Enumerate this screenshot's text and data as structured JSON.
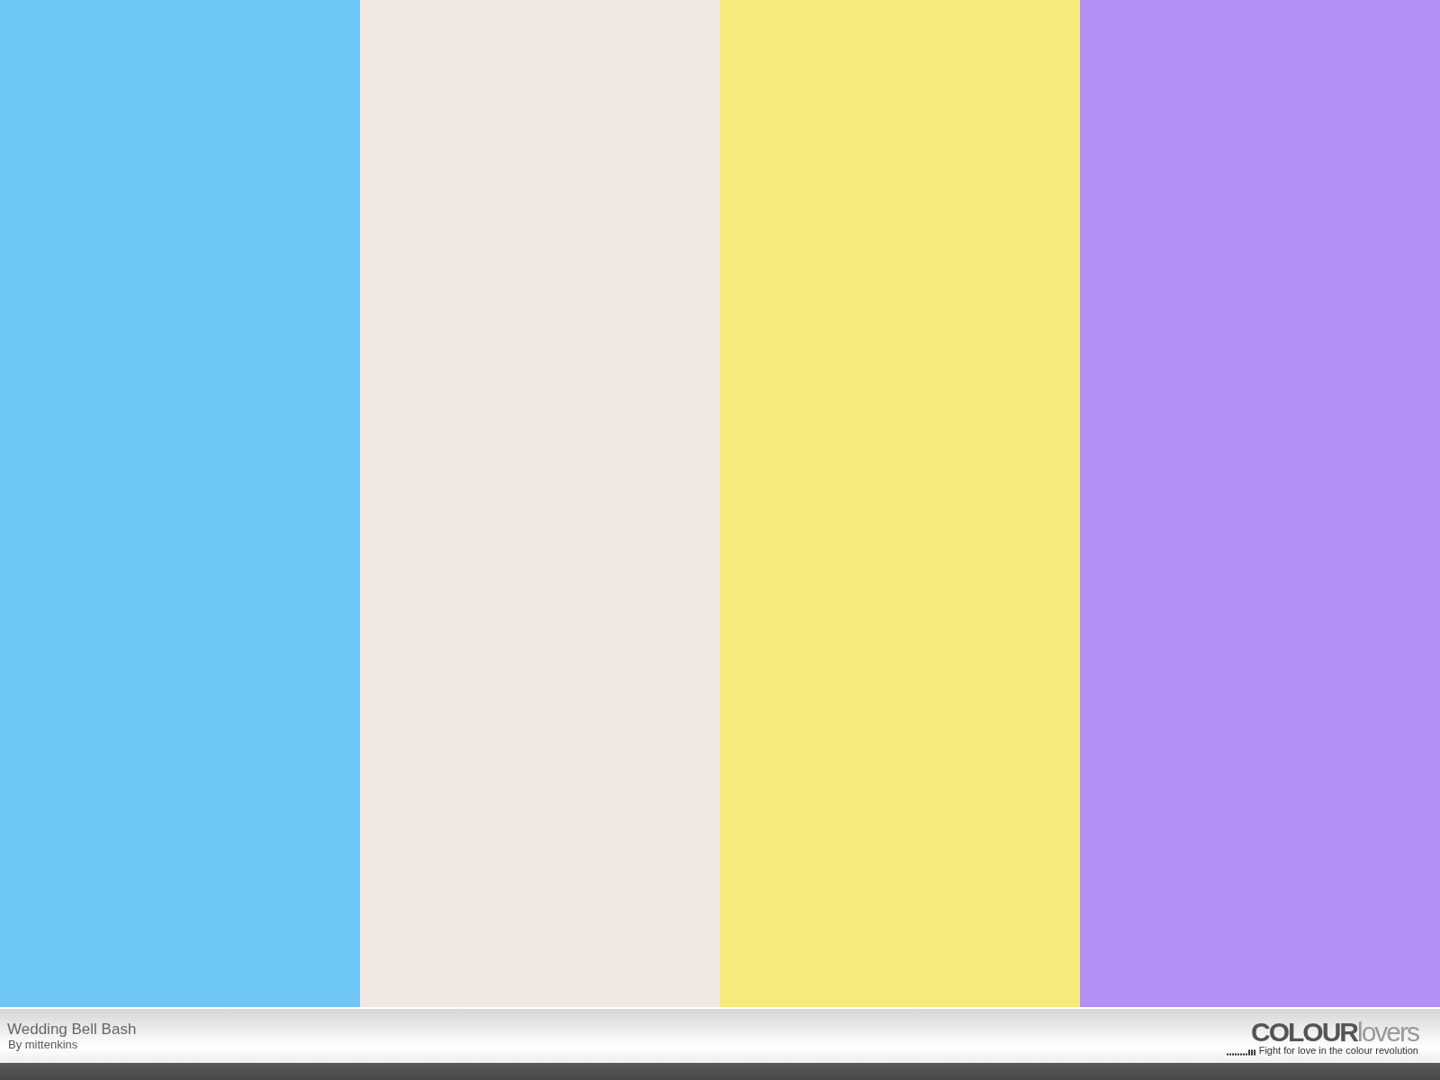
{
  "swatches": [
    {
      "color": "#6ec6f7"
    },
    {
      "color": "#f2e8e3"
    },
    {
      "color": "#f6eb7a"
    },
    {
      "color": "#b390f5"
    }
  ],
  "palette": {
    "title": "Wedding Bell Bash",
    "author": "By mittenkins"
  },
  "logo": {
    "strong": "COLOUR",
    "light": "lovers",
    "tagline": "Fight for love in the colour revolution"
  }
}
